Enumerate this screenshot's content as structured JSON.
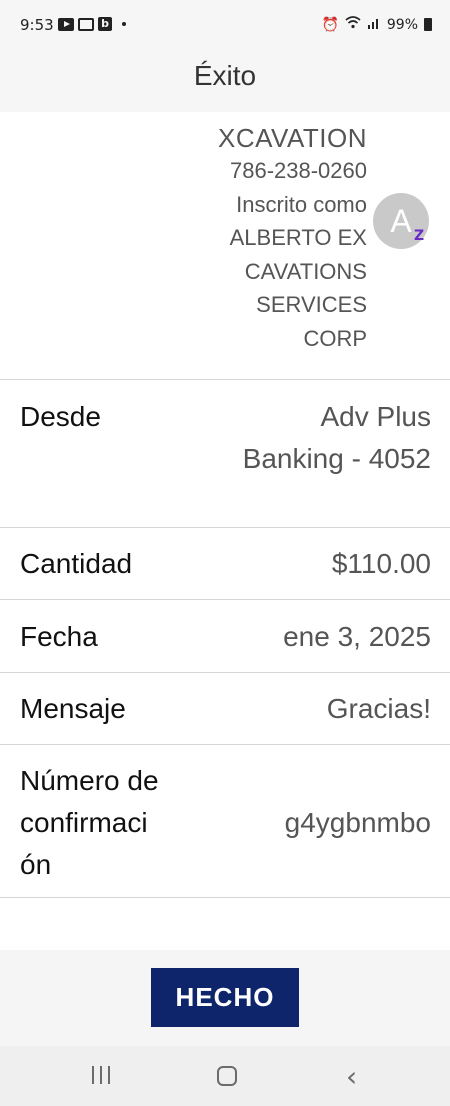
{
  "status_bar": {
    "time": "9:53",
    "battery": "99%"
  },
  "header": {
    "title": "Éxito"
  },
  "payee": {
    "name": "XCAVATION",
    "phone": "786-238-0260",
    "enrolled_lines": [
      "Inscrito como",
      "ALBERTO EX",
      "CAVATIONS",
      "SERVICES",
      "CORP"
    ],
    "avatar_initial": "A",
    "avatar_badge": "Z"
  },
  "details": {
    "from": {
      "label": "Desde",
      "value_lines": [
        "Adv Plus",
        "Banking - 4052"
      ]
    },
    "amount": {
      "label": "Cantidad",
      "value": "$110.00"
    },
    "date": {
      "label": "Fecha",
      "value": "ene 3, 2025"
    },
    "message": {
      "label": "Mensaje",
      "value": "Gracias!"
    },
    "confirmation": {
      "label_lines": [
        "Número de",
        "confirmaci",
        "ón"
      ],
      "value": "g4ygbnmbo"
    }
  },
  "footer": {
    "done_label": "HECHO"
  },
  "colors": {
    "primary_button": "#0e246b",
    "zelle_purple": "#6a2bc4"
  }
}
